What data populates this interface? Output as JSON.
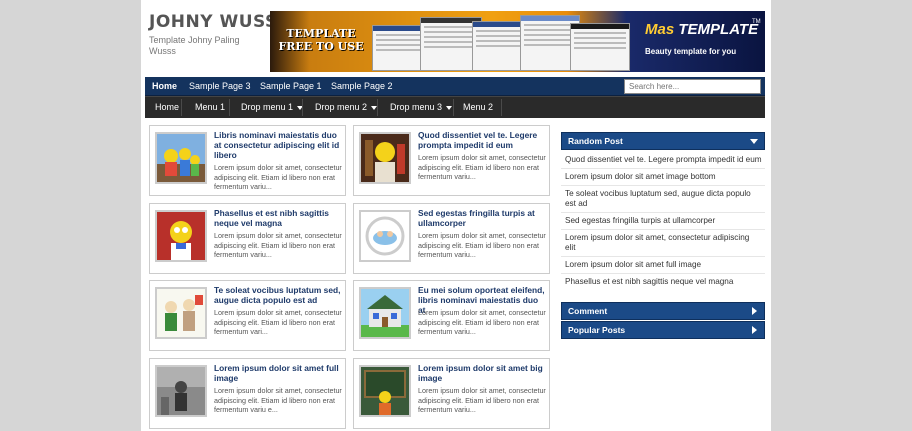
{
  "header": {
    "title": "JOHNY WUSSS",
    "description": "Template Johny Paling Wusss",
    "banner": {
      "left_text": "TEMPLATE FREE TO USE",
      "logo_mas": "Mas",
      "logo_template": "TEMPLATE",
      "logo_tm": "TM",
      "tagline": "Beauty template for you"
    }
  },
  "nav1": {
    "items": [
      "Home",
      "Sample Page 3",
      "Sample Page 1",
      "Sample Page 2"
    ],
    "search_placeholder": "Search here..."
  },
  "nav2": {
    "items": [
      "Home",
      "Menu 1",
      "Drop menu 1",
      "Drop menu 2",
      "Drop menu 3",
      "Menu 2"
    ]
  },
  "posts": [
    {
      "title": "Libris nominavi maiestatis duo at consectetur adipiscing elit id libero",
      "snippet": "Lorem ipsum dolor sit amet, consectetur adipiscing elit. Etiam id libero non erat fermentum variu..."
    },
    {
      "title": "Quod dissentiet vel te. Legere prompta impedit id eum",
      "snippet": "Lorem ipsum dolor sit amet, consectetur adipiscing elit. Etiam id libero non erat fermentum variu..."
    },
    {
      "title": "Phasellus et est nibh sagittis neque vel magna",
      "snippet": "Lorem ipsum dolor sit amet, consectetur adipiscing elit. Etiam id libero non erat fermentum variu..."
    },
    {
      "title": "Sed egestas fringilla turpis at ullamcorper",
      "snippet": "Lorem ipsum dolor sit amet, consectetur adipiscing elit. Etiam id libero non erat fermentum variu..."
    },
    {
      "title": "Te soleat vocibus luptatum sed, augue dicta populo est ad",
      "snippet": "Lorem ipsum dolor sit amet, consectetur adipiscing elit. Etiam id libero non erat fermentum vari..."
    },
    {
      "title": "Eu mei solum oporteat eleifend, libris nominavi maiestatis duo at",
      "snippet": "Lorem ipsum dolor sit amet, consectetur adipiscing elit. Etiam id libero non erat fermentum variu..."
    },
    {
      "title": "Lorem ipsum dolor sit amet full image",
      "snippet": "Lorem ipsum dolor sit amet, consectetur adipiscing elit. Etiam id libero non erat fermentum variu e..."
    },
    {
      "title": "Lorem ipsum dolor sit amet big image",
      "snippet": "Lorem ipsum dolor sit amet, consectetur adipiscing elit. Etiam id libero non erat fermentum variu..."
    }
  ],
  "sidebar": {
    "random_post": {
      "title": "Random Post",
      "items": [
        "Quod dissentiet vel te. Legere prompta impedit id eum",
        "Lorem ipsum dolor sit amet image bottom",
        "Te soleat vocibus luptatum sed, augue dicta populo est ad",
        "Sed egestas fringilla turpis at ullamcorper",
        "Lorem ipsum dolor sit amet, consectetur adipiscing elit",
        "Lorem ipsum dolor sit amet full image",
        "Phasellus et est nibh sagittis neque vel magna"
      ]
    },
    "comment": {
      "title": "Comment"
    },
    "popular": {
      "title": "Popular Posts"
    }
  },
  "colors": {
    "nav_primary": "#14335e",
    "nav_secondary": "#2a2a2a",
    "widget_header": "#1b4a87",
    "post_title": "#1e3a6a",
    "background": "#d6d6d6"
  }
}
